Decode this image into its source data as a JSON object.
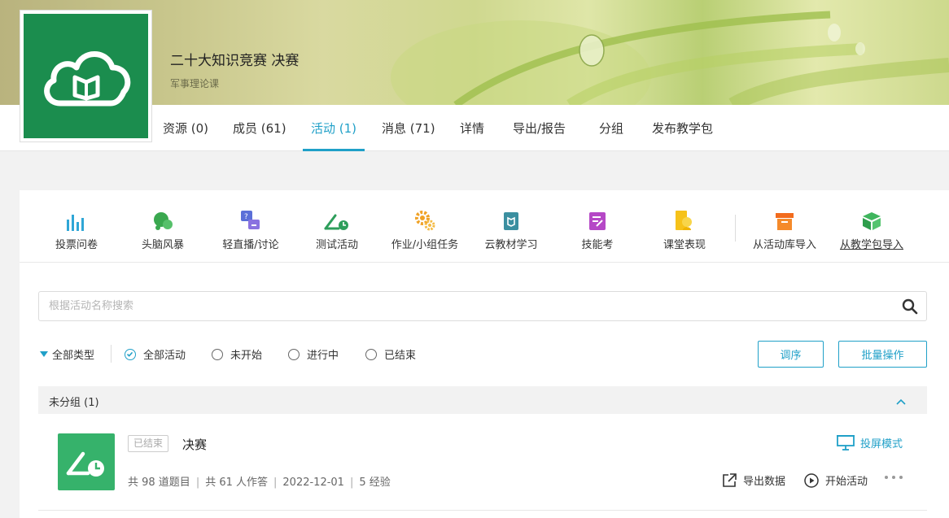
{
  "course": {
    "title": "二十大知识竞赛 决赛",
    "subtitle": "军事理论课"
  },
  "nav": {
    "tabs": [
      {
        "label": "资源 (0)"
      },
      {
        "label": "成员 (61)"
      },
      {
        "label": "活动 (1)",
        "active": true
      },
      {
        "label": "消息 (71)"
      },
      {
        "label": "详情"
      },
      {
        "label": "导出/报告"
      },
      {
        "label": "分组"
      },
      {
        "label": "发布教学包"
      }
    ]
  },
  "toolbar": {
    "items": [
      {
        "label": "投票问卷",
        "icon": "bar-chart-icon"
      },
      {
        "label": "头脑风暴",
        "icon": "brainstorm-bubble-icon"
      },
      {
        "label": "轻直播/讨论",
        "icon": "live-discussion-icon"
      },
      {
        "label": "测试活动",
        "icon": "test-clock-icon"
      },
      {
        "label": "作业/小组任务",
        "icon": "gears-icon"
      },
      {
        "label": "云教材学习",
        "icon": "cloud-book-icon"
      },
      {
        "label": "技能考",
        "icon": "skill-exam-icon"
      },
      {
        "label": "课堂表现",
        "icon": "classroom-performance-icon"
      },
      {
        "label": "从活动库导入",
        "icon": "archive-box-icon"
      },
      {
        "label": "从教学包导入",
        "icon": "package-cube-icon"
      }
    ]
  },
  "search": {
    "placeholder": "根据活动名称搜索",
    "value": ""
  },
  "filters": {
    "type_label": "全部类型",
    "options": [
      {
        "label": "全部活动",
        "checked": true
      },
      {
        "label": "未开始",
        "checked": false
      },
      {
        "label": "进行中",
        "checked": false
      },
      {
        "label": "已结束",
        "checked": false
      }
    ],
    "sort_button": "调序",
    "batch_button": "批量操作"
  },
  "group": {
    "title": "未分组 (1)"
  },
  "activity": {
    "status": "已结束",
    "title": "决赛",
    "questions": "共 98 道题目",
    "answered": "共 61 人作答",
    "date": "2022-12-01",
    "exp": "5 经验",
    "projection": "投屏模式",
    "export": "导出数据",
    "start": "开始活动"
  },
  "colors": {
    "accent": "#20a0c8",
    "logo_green": "#1b8d4e",
    "activity_green": "#36b26b"
  }
}
